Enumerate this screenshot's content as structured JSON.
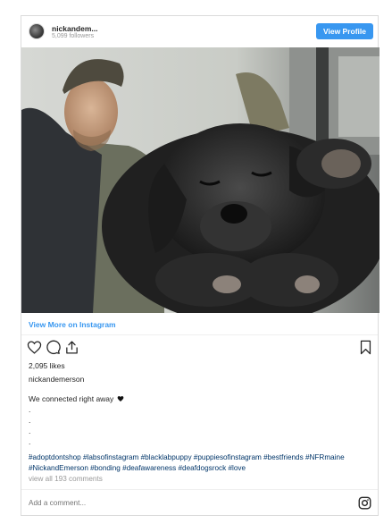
{
  "header": {
    "username": "nickandem...",
    "followers": "5,099 followers",
    "view_profile_label": "View Profile"
  },
  "post": {
    "photo_alt": "Man with sleeping black lab puppy",
    "view_more_label": "View More on Instagram",
    "likes": "2,095 likes",
    "author": "nickandemerson",
    "caption": "We connected right away",
    "dots": [
      ".",
      ".",
      ".",
      ".",
      "."
    ],
    "hashtags_line1": "#adoptdontshop #labsofinstagram #blacklabpuppy #puppiesofinstagram #bestfriends #NFRmaine",
    "hashtags_line2": "#NickandEmerson #bonding #deafawareness #deafdogsrock #love",
    "comments_link": "view all 193 comments",
    "add_comment_placeholder": "Add a comment..."
  },
  "icons": {
    "like": "heart-outline-icon",
    "comment": "comment-bubble-icon",
    "share": "share-upload-icon",
    "save": "bookmark-icon",
    "brand": "instagram-logo-icon",
    "caption_emoji": "black-heart-icon"
  },
  "colors": {
    "link_blue": "#3897f0",
    "hashtag_blue": "#003569",
    "muted": "#999999",
    "border": "#dbdbdb"
  }
}
